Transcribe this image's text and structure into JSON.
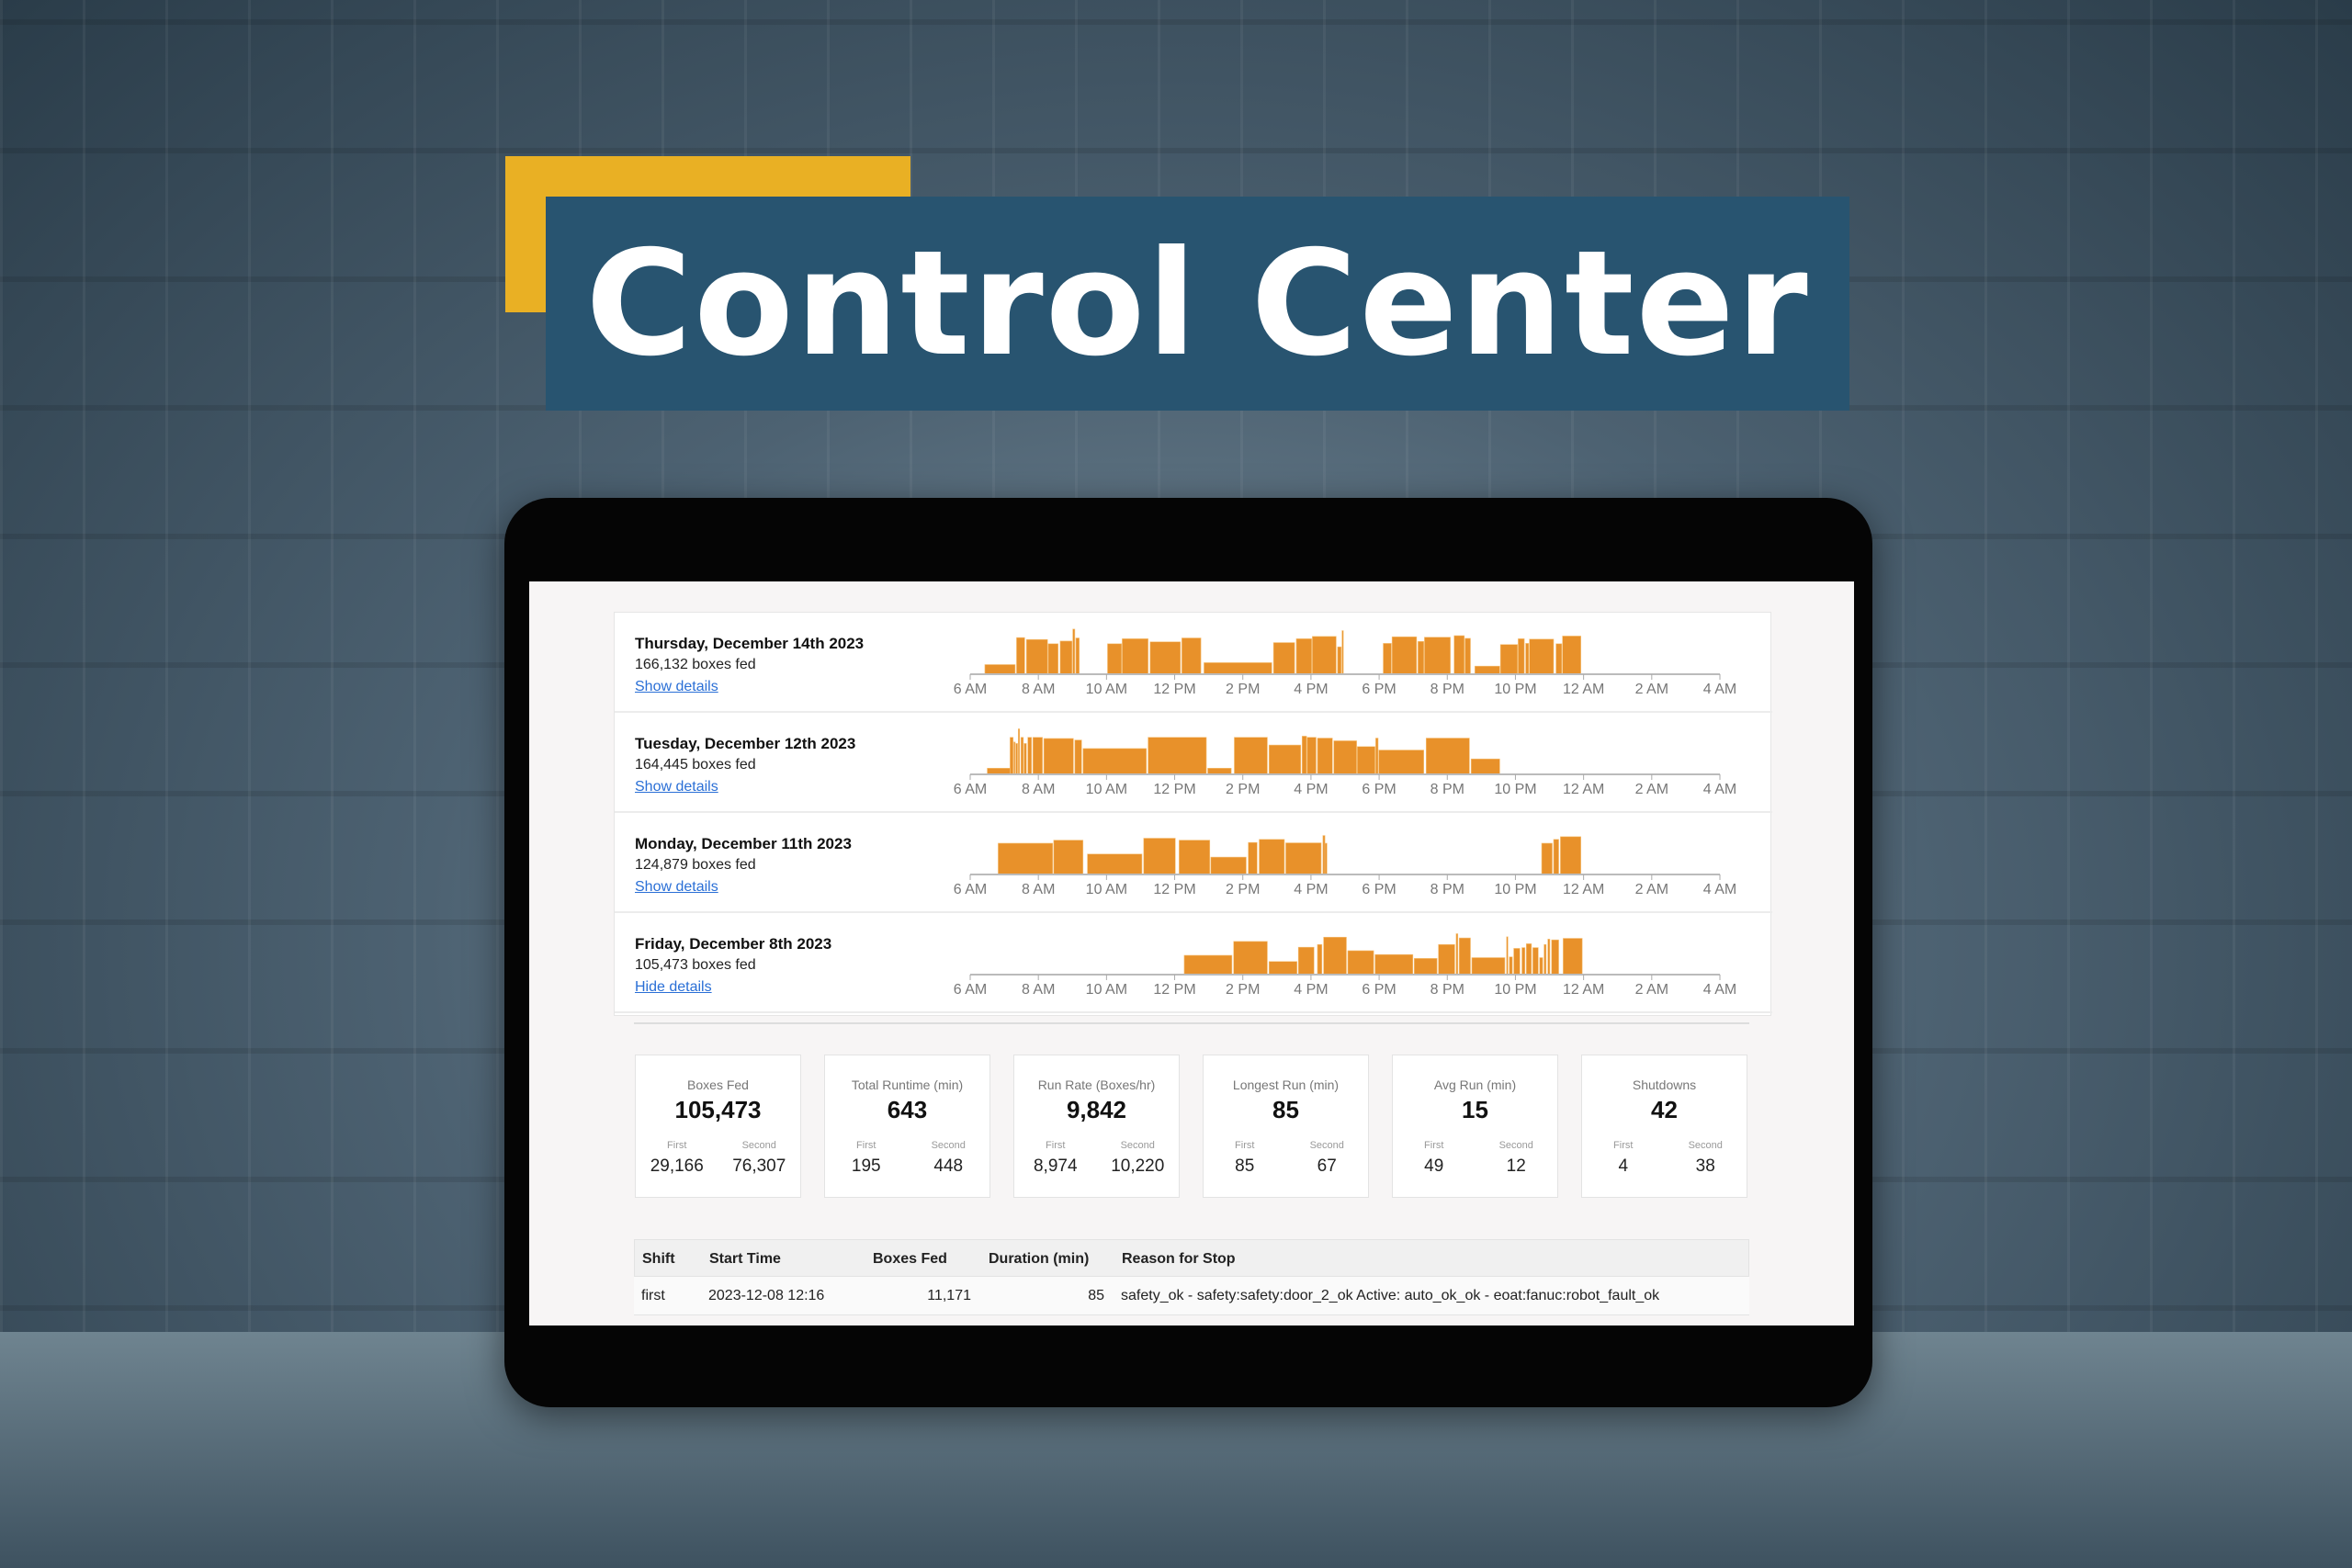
{
  "title": "Control Center",
  "colors": {
    "banner": "#285470",
    "accent_block": "#e9b024",
    "bar": "#e8912a",
    "link": "#2a6fd6"
  },
  "days": [
    {
      "title": "Thursday, December 14th 2023",
      "subtitle": "166,132 boxes fed",
      "link": "Show details"
    },
    {
      "title": "Tuesday, December 12th 2023",
      "subtitle": "164,445 boxes fed",
      "link": "Show details"
    },
    {
      "title": "Monday, December 11th 2023",
      "subtitle": "124,879 boxes fed",
      "link": "Show details"
    },
    {
      "title": "Friday, December 8th 2023",
      "subtitle": "105,473 boxes fed",
      "link": "Hide details"
    }
  ],
  "chart_data": {
    "type": "bar",
    "xlabel": "",
    "ylabel": "",
    "x_ticks": [
      "6 AM",
      "8 AM",
      "10 AM",
      "12 PM",
      "2 PM",
      "4 PM",
      "6 PM",
      "8 PM",
      "10 PM",
      "12 AM",
      "2 AM",
      "4 AM"
    ],
    "xlim_hours": [
      6,
      28
    ],
    "segment_format": [
      "start_hour",
      "end_hour",
      "relative_rate_percent"
    ],
    "series": [
      {
        "segments": [
          [
            6.43,
            7.32,
            25
          ],
          [
            7.36,
            7.6,
            95
          ],
          [
            7.65,
            8.27,
            90
          ],
          [
            8.29,
            8.58,
            79
          ],
          [
            8.64,
            8.99,
            86
          ],
          [
            9.01,
            9.07,
            117
          ],
          [
            9.1,
            9.2,
            94
          ],
          [
            10.03,
            10.44,
            79
          ],
          [
            10.46,
            11.22,
            92
          ],
          [
            11.28,
            12.17,
            84
          ],
          [
            12.21,
            12.77,
            94
          ],
          [
            12.86,
            14.85,
            30
          ],
          [
            14.9,
            15.52,
            82
          ],
          [
            15.57,
            16.02,
            92
          ],
          [
            16.04,
            16.74,
            98
          ],
          [
            16.78,
            16.89,
            71
          ],
          [
            16.91,
            16.95,
            113
          ],
          [
            18.12,
            18.36,
            80
          ],
          [
            18.38,
            19.1,
            97
          ],
          [
            19.14,
            19.31,
            85
          ],
          [
            19.33,
            20.09,
            96
          ],
          [
            20.2,
            20.5,
            100
          ],
          [
            20.52,
            20.68,
            93
          ],
          [
            20.81,
            21.54,
            21
          ],
          [
            21.56,
            22.06,
            77
          ],
          [
            22.08,
            22.26,
            92
          ],
          [
            22.3,
            22.39,
            80
          ],
          [
            22.41,
            23.12,
            91
          ],
          [
            23.19,
            23.36,
            79
          ],
          [
            23.38,
            23.92,
            99
          ]
        ]
      },
      {
        "segments": [
          [
            6.5,
            7.17,
            16
          ],
          [
            7.17,
            7.26,
            96
          ],
          [
            7.28,
            7.32,
            84
          ],
          [
            7.34,
            7.39,
            80
          ],
          [
            7.41,
            7.45,
            118
          ],
          [
            7.49,
            7.56,
            96
          ],
          [
            7.58,
            7.65,
            80
          ],
          [
            7.69,
            7.8,
            96
          ],
          [
            7.84,
            8.12,
            96
          ],
          [
            8.16,
            9.03,
            93
          ],
          [
            9.07,
            9.27,
            89
          ],
          [
            9.31,
            11.17,
            67
          ],
          [
            11.22,
            12.93,
            96
          ],
          [
            12.97,
            13.66,
            16
          ],
          [
            13.75,
            14.72,
            96
          ],
          [
            14.77,
            15.7,
            76
          ],
          [
            15.74,
            15.87,
            99
          ],
          [
            15.89,
            16.15,
            96
          ],
          [
            16.19,
            16.63,
            94
          ],
          [
            16.67,
            17.34,
            87
          ],
          [
            17.36,
            17.88,
            72
          ],
          [
            17.9,
            17.97,
            94
          ],
          [
            17.99,
            19.31,
            63
          ],
          [
            19.38,
            20.65,
            94
          ],
          [
            20.7,
            21.54,
            40
          ]
        ]
      },
      {
        "segments": [
          [
            6.82,
            8.42,
            81
          ],
          [
            8.45,
            9.31,
            89
          ],
          [
            9.44,
            11.04,
            53
          ],
          [
            11.09,
            12.02,
            94
          ],
          [
            12.13,
            13.03,
            89
          ],
          [
            13.06,
            14.1,
            45
          ],
          [
            14.16,
            14.42,
            83
          ],
          [
            14.48,
            15.22,
            91
          ],
          [
            15.26,
            16.3,
            82
          ],
          [
            16.35,
            16.41,
            101
          ],
          [
            16.41,
            16.47,
            81
          ],
          [
            22.77,
            23.08,
            81
          ],
          [
            23.12,
            23.27,
            91
          ],
          [
            23.32,
            23.92,
            98
          ]
        ]
      },
      {
        "segments": [
          [
            12.28,
            13.68,
            50
          ],
          [
            13.73,
            14.72,
            86
          ],
          [
            14.77,
            15.59,
            34
          ],
          [
            15.63,
            16.09,
            71
          ],
          [
            16.19,
            16.32,
            78
          ],
          [
            16.37,
            17.04,
            97
          ],
          [
            17.08,
            17.84,
            62
          ],
          [
            17.88,
            18.99,
            52
          ],
          [
            19.03,
            19.7,
            42
          ],
          [
            19.74,
            20.22,
            78
          ],
          [
            20.26,
            20.31,
            106
          ],
          [
            20.35,
            20.39,
            54
          ],
          [
            20.35,
            20.68,
            95
          ],
          [
            20.72,
            21.69,
            44
          ],
          [
            21.74,
            21.78,
            98
          ],
          [
            21.82,
            21.91,
            46
          ],
          [
            21.95,
            22.13,
            68
          ],
          [
            22.19,
            22.28,
            70
          ],
          [
            22.32,
            22.47,
            80
          ],
          [
            22.51,
            22.67,
            70
          ],
          [
            22.71,
            22.8,
            44
          ],
          [
            22.84,
            22.9,
            78
          ],
          [
            22.95,
            23.01,
            92
          ],
          [
            23.06,
            23.27,
            90
          ],
          [
            23.4,
            23.96,
            94
          ]
        ]
      }
    ]
  },
  "stats": [
    {
      "label": "Boxes Fed",
      "value": "105,473",
      "first": "29,166",
      "second": "76,307"
    },
    {
      "label": "Total Runtime (min)",
      "value": "643",
      "first": "195",
      "second": "448"
    },
    {
      "label": "Run Rate (Boxes/hr)",
      "value": "9,842",
      "first": "8,974",
      "second": "10,220"
    },
    {
      "label": "Longest Run (min)",
      "value": "85",
      "first": "85",
      "second": "67"
    },
    {
      "label": "Avg Run (min)",
      "value": "15",
      "first": "49",
      "second": "12"
    },
    {
      "label": "Shutdowns",
      "value": "42",
      "first": "4",
      "second": "38"
    }
  ],
  "stat_sub_labels": {
    "first": "First",
    "second": "Second"
  },
  "table": {
    "headers": [
      "Shift",
      "Start Time",
      "Boxes Fed",
      "Duration (min)",
      "Reason for Stop"
    ],
    "rows": [
      [
        "first",
        "2023-12-08 12:16",
        "11,171",
        "85",
        "safety_ok - safety:safety:door_2_ok Active: auto_ok_ok - eoat:fanuc:robot_fault_ok"
      ]
    ]
  }
}
